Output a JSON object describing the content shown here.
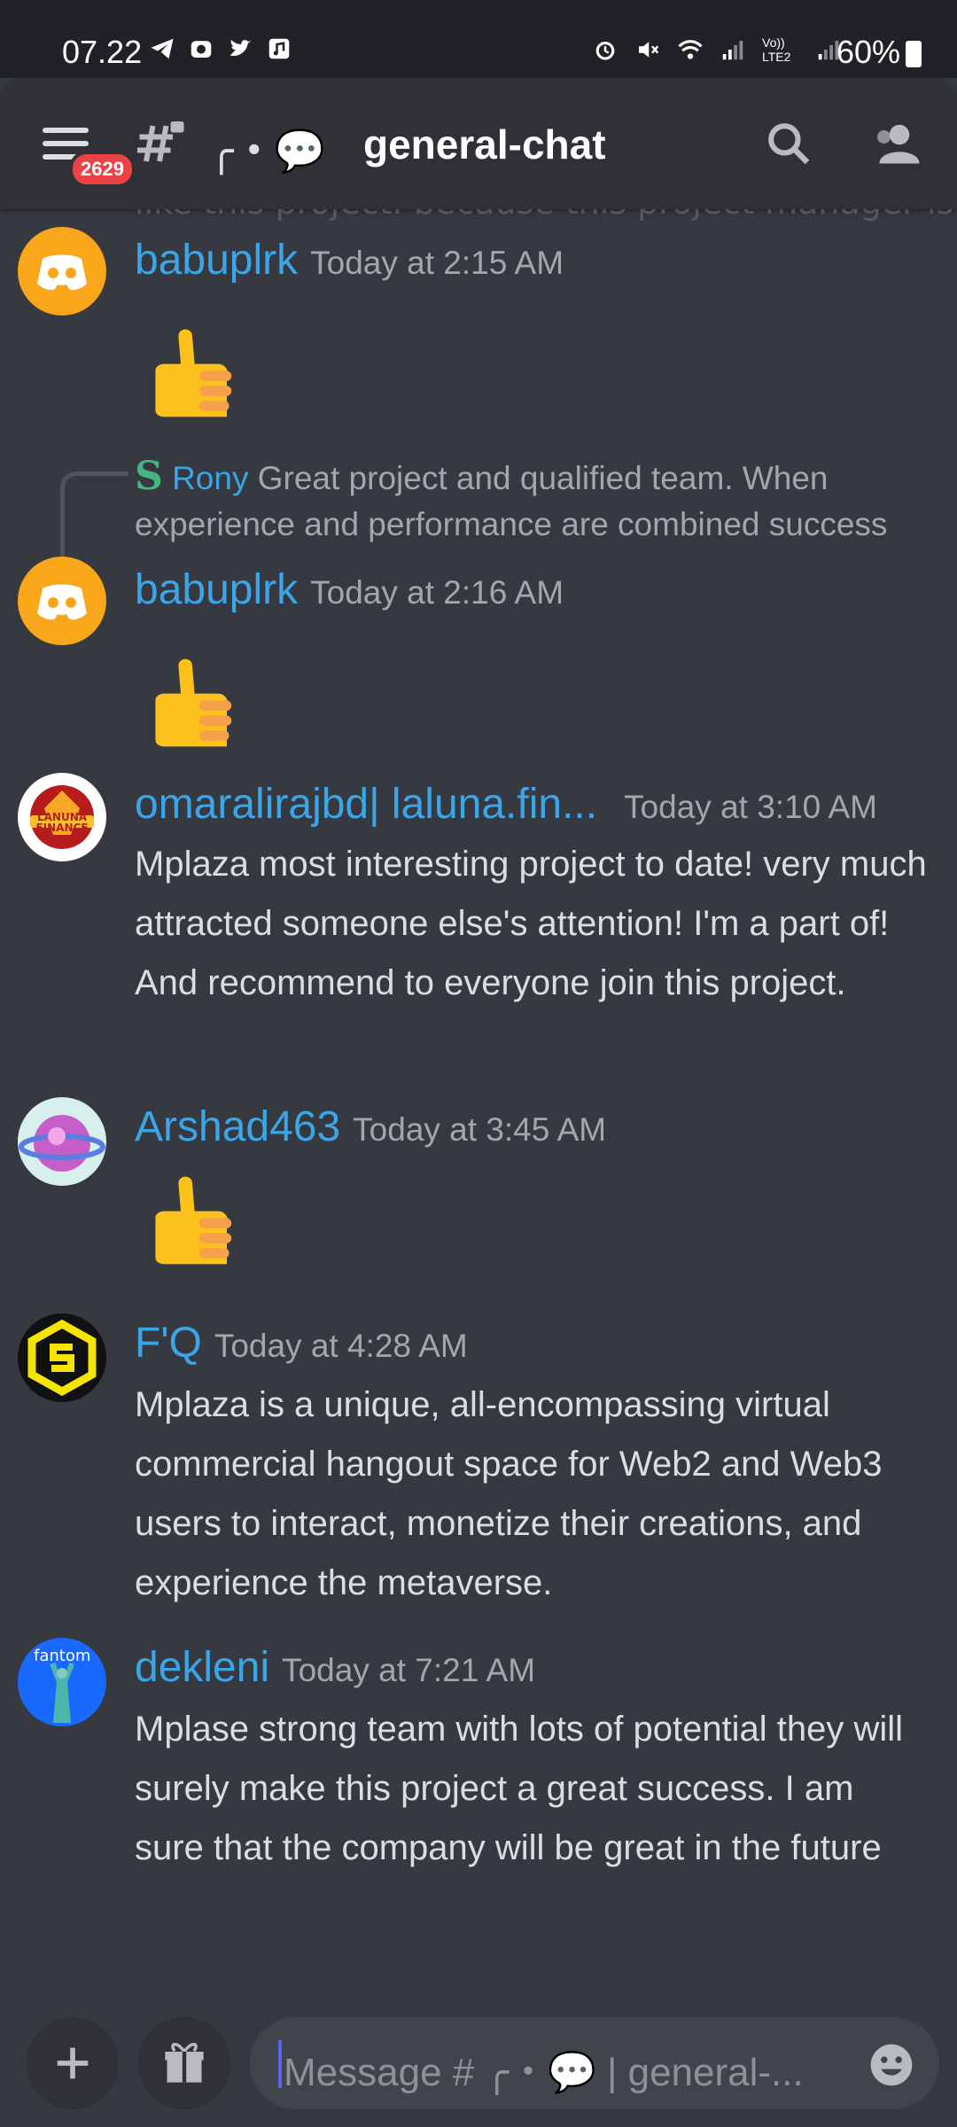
{
  "status_bar": {
    "time": "07.22",
    "battery": "60%",
    "network_label": "Vo)) LTE2"
  },
  "header": {
    "notification_count": "2629",
    "channel_prefix": "╭・💬",
    "channel_name": "general-chat"
  },
  "faded_text": "like this project. because this project manager is",
  "messages": [
    {
      "username": "babuplrk",
      "timestamp": "Today at 2:15 AM",
      "content": "👍"
    },
    {
      "reply_user": "Rony",
      "reply_text": "Great project and qualified team. When experience and performance are combined success"
    },
    {
      "username": "babuplrk",
      "timestamp": "Today at 2:16 AM",
      "content": "👍"
    },
    {
      "username": "omaralirajbd| laluna.fin...",
      "timestamp": "Today at 3:10 AM",
      "content": "Mplaza most interesting project to date! very much attracted someone else's attention! I'm a part of! And recommend to everyone join this project.",
      "avatar_text": "LANUNA FINANCE"
    },
    {
      "username": "Arshad463",
      "timestamp": "Today at 3:45 AM",
      "content": "👍"
    },
    {
      "username": "F'Q",
      "timestamp": "Today at 4:28 AM",
      "content": "Mplaza is a unique, all-encompassing virtual commercial hangout space for Web2 and Web3 users to interact, monetize their creations, and experience the metaverse."
    },
    {
      "username": "dekleni",
      "timestamp": "Today at 7:21 AM",
      "content": "Mplase  strong team with lots of potential they will surely make this project a great success. I am sure that the company will be great in the future",
      "avatar_text": "fantom"
    }
  ],
  "composer": {
    "placeholder": "Message # ╭・💬 | general-..."
  },
  "colors": {
    "background": "#36393f",
    "header": "#2f3136",
    "username": "#3ba5e8",
    "badge": "#ed4245",
    "discord_orange": "#faa61a"
  }
}
